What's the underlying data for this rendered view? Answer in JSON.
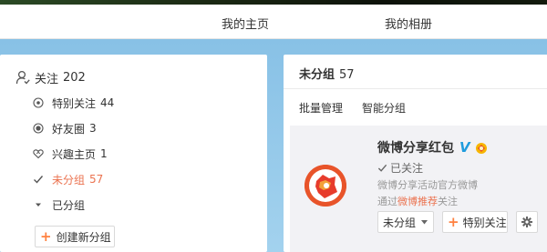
{
  "nav": {
    "home_label": "我的主页",
    "album_label": "我的相册"
  },
  "sidebar": {
    "follow_label": "关注",
    "follow_count": "202",
    "groups": [
      {
        "label": "特别关注",
        "count": "44",
        "icon": "eye-circle-icon"
      },
      {
        "label": "好友圈",
        "count": "3",
        "icon": "friend-circle-icon"
      },
      {
        "label": "兴趣主页",
        "count": "1",
        "icon": "heart-icon"
      },
      {
        "label": "未分组",
        "count": "57",
        "icon": "check-icon",
        "active": true
      },
      {
        "label": "已分组",
        "count": "",
        "icon": "triangle-down-icon"
      }
    ],
    "create_group_label": "创建新分组"
  },
  "main": {
    "title": "未分组",
    "count": "57",
    "tabs": [
      {
        "label": "批量管理"
      },
      {
        "label": "智能分组"
      }
    ],
    "card": {
      "name": "微博分享红包",
      "verified_badge": "V",
      "followed_label": "已关注",
      "description": "微博分享活动官方微博",
      "via_prefix": "通过",
      "via_link": "微博推荐",
      "via_suffix": "关注",
      "group_button_label": "未分组",
      "special_follow_label": "特别关注"
    }
  },
  "colors": {
    "accent_orange": "#eb7350",
    "plus_orange": "#ff8140",
    "verified_blue": "#1f9cdd",
    "background_blue": "#8fc7e9"
  }
}
